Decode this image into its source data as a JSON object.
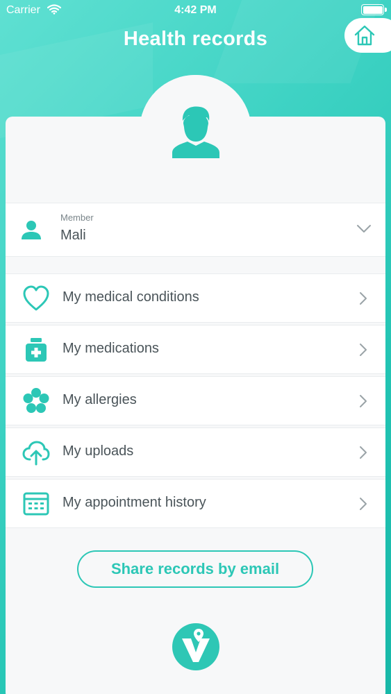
{
  "status_bar": {
    "carrier": "Carrier",
    "time": "4:42 PM",
    "battery_level": 1.0
  },
  "header": {
    "title": "Health records"
  },
  "member": {
    "caption": "Member",
    "name": "Mali"
  },
  "menu": [
    {
      "label": "My medical conditions",
      "icon": "heart-icon"
    },
    {
      "label": "My medications",
      "icon": "medicine-bottle-icon"
    },
    {
      "label": "My allergies",
      "icon": "flower-icon"
    },
    {
      "label": "My uploads",
      "icon": "cloud-upload-icon"
    },
    {
      "label": "My appointment history",
      "icon": "calendar-icon"
    }
  ],
  "share_label": "Share records by email",
  "colors": {
    "accent": "#2cc7b6",
    "text": "#4a5459",
    "card": "#f7f8f9"
  }
}
